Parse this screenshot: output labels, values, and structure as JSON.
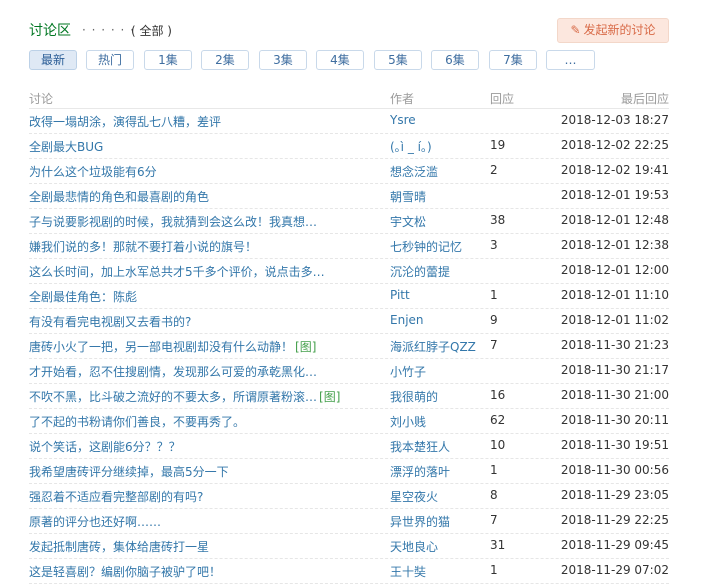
{
  "header": {
    "title": "讨论区",
    "dots": "· · · · · ·",
    "scope": "( 全部 )",
    "new_button": "发起新的讨论"
  },
  "tabs": [
    "最新",
    "热门",
    "1集",
    "2集",
    "3集",
    "4集",
    "5集",
    "6集",
    "7集",
    "…"
  ],
  "active_tab": "最新",
  "columns": {
    "topic": "讨论",
    "author": "作者",
    "replies": "回应",
    "last": "最后回应"
  },
  "rows": [
    {
      "topic": "改得一塌胡涂，演得乱七八糟，差评",
      "pic": "",
      "author": "Ysre",
      "replies": "",
      "last": "2018-12-03 18:27"
    },
    {
      "topic": "全剧最大BUG",
      "pic": "",
      "author": "(｡ì _ í｡)",
      "replies": "19",
      "last": "2018-12-02 22:25"
    },
    {
      "topic": "为什么这个垃圾能有6分",
      "pic": "",
      "author": "想念泛滥",
      "replies": "2",
      "last": "2018-12-02 19:41"
    },
    {
      "topic": "全剧最悲情的角色和最喜剧的角色",
      "pic": "",
      "author": "朝雪晴",
      "replies": "",
      "last": "2018-12-01 19:53"
    },
    {
      "topic": "子与说要影视剧的时候，我就猜到会这么改！我真想…",
      "pic": "",
      "author": "宇文松",
      "replies": "38",
      "last": "2018-12-01 12:48"
    },
    {
      "topic": "嫌我们说的多！那就不要打着小说的旗号！",
      "pic": "",
      "author": "七秒钟的记忆",
      "replies": "3",
      "last": "2018-12-01 12:38"
    },
    {
      "topic": "这么长时间，加上水军总共才5千多个评价，说点击多…",
      "pic": "",
      "author": "沉沦的蕾提",
      "replies": "",
      "last": "2018-12-01 12:00"
    },
    {
      "topic": "全剧最佳角色：陈彪",
      "pic": "",
      "author": "Pitt",
      "replies": "1",
      "last": "2018-12-01 11:10"
    },
    {
      "topic": "有没有看完电视剧又去看书的?",
      "pic": "",
      "author": "Enjen",
      "replies": "9",
      "last": "2018-12-01 11:02"
    },
    {
      "topic": "唐砖小火了一把，另一部电视剧却没有什么动静！",
      "pic": "[图]",
      "author": "海派红脖子QZZ",
      "replies": "7",
      "last": "2018-11-30 21:23"
    },
    {
      "topic": "才开始看，忍不住搜剧情，发现那么可爱的承乾黑化…",
      "pic": "",
      "author": "小竹子",
      "replies": "",
      "last": "2018-11-30 21:17"
    },
    {
      "topic": "不吹不黑，比斗破之流好的不要太多，所谓原著粉滚…",
      "pic": "[图]",
      "author": "我很萌的",
      "replies": "16",
      "last": "2018-11-30 21:00"
    },
    {
      "topic": "了不起的书粉请你们善良，不要再秀了。",
      "pic": "",
      "author": "刘小贱",
      "replies": "62",
      "last": "2018-11-30 20:11"
    },
    {
      "topic": "说个笑话，这剧能6分？？？",
      "pic": "",
      "author": "我本楚狂人",
      "replies": "10",
      "last": "2018-11-30 19:51"
    },
    {
      "topic": "我希望唐砖评分继续掉，最高5分一下",
      "pic": "",
      "author": "漂浮的落叶",
      "replies": "1",
      "last": "2018-11-30 00:56"
    },
    {
      "topic": "强忍着不适应看完整部剧的有吗?",
      "pic": "",
      "author": "星空夜火",
      "replies": "8",
      "last": "2018-11-29 23:05"
    },
    {
      "topic": "原著的评分也还好啊……",
      "pic": "",
      "author": "异世界的猫",
      "replies": "7",
      "last": "2018-11-29 22:25"
    },
    {
      "topic": "发起抵制唐砖，集体给唐砖打一星",
      "pic": "",
      "author": "天地良心",
      "replies": "31",
      "last": "2018-11-29 09:45"
    },
    {
      "topic": "这是轻喜剧？编剧你脑子被驴了吧！",
      "pic": "",
      "author": "王十奘",
      "replies": "1",
      "last": "2018-11-29 07:02"
    }
  ]
}
